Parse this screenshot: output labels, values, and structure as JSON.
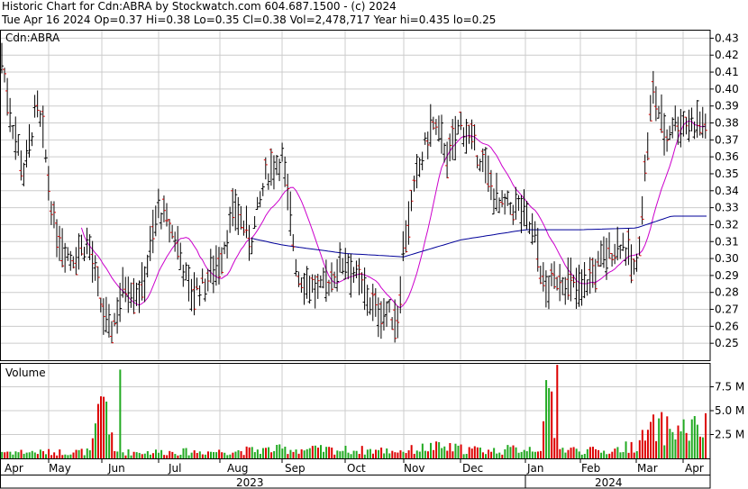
{
  "header": {
    "line1": "Historic Chart for Cdn:ABRA by Stockwatch.com 604.687.1500 - (c) 2024",
    "line2": "Tue Apr 16 2024  Op=0.37  Hi=0.38  Lo=0.35  Cl=0.38  Vol=2,478,717  Year hi=0.435  lo=0.25"
  },
  "colors": {
    "up": "#dd0000",
    "down": "#000000",
    "ma_short": "#cc00cc",
    "ma_long": "#000099",
    "vol_up": "#22aa22",
    "vol_down": "#dd0000"
  },
  "chart_data": {
    "type": "bar",
    "title": "Cdn:ABRA",
    "price_axis": {
      "ylim": [
        0.24,
        0.435
      ],
      "ticks": [
        "0.43",
        "0.42",
        "0.41",
        "0.40",
        "0.39",
        "0.38",
        "0.37",
        "0.36",
        "0.35",
        "0.34",
        "0.33",
        "0.32",
        "0.31",
        "0.30",
        "0.29",
        "0.28",
        "0.27",
        "0.26",
        "0.25"
      ]
    },
    "volume_axis": {
      "label": "Volume",
      "ylim": [
        0,
        10
      ],
      "ticks": [
        "7.5 M",
        "5.0 M",
        "2.5 M"
      ]
    },
    "months": [
      "Apr",
      "May",
      "Jun",
      "Jul",
      "Aug",
      "Sep",
      "Oct",
      "Nov",
      "Dec",
      "Jan",
      "Feb",
      "Mar",
      "Apr"
    ],
    "years": [
      "2023",
      "2024"
    ],
    "price_anchors": [
      {
        "m": 0.0,
        "v": 0.425
      },
      {
        "m": 0.25,
        "v": 0.38
      },
      {
        "m": 0.5,
        "v": 0.35
      },
      {
        "m": 0.75,
        "v": 0.39
      },
      {
        "m": 0.9,
        "v": 0.37
      },
      {
        "m": 1.1,
        "v": 0.32
      },
      {
        "m": 1.4,
        "v": 0.3
      },
      {
        "m": 1.75,
        "v": 0.31
      },
      {
        "m": 2.0,
        "v": 0.27
      },
      {
        "m": 2.15,
        "v": 0.255
      },
      {
        "m": 2.4,
        "v": 0.285
      },
      {
        "m": 2.7,
        "v": 0.28
      },
      {
        "m": 3.0,
        "v": 0.33
      },
      {
        "m": 3.3,
        "v": 0.31
      },
      {
        "m": 3.5,
        "v": 0.28
      },
      {
        "m": 3.75,
        "v": 0.285
      },
      {
        "m": 4.0,
        "v": 0.3
      },
      {
        "m": 4.25,
        "v": 0.33
      },
      {
        "m": 4.5,
        "v": 0.31
      },
      {
        "m": 4.75,
        "v": 0.35
      },
      {
        "m": 5.0,
        "v": 0.36
      },
      {
        "m": 5.25,
        "v": 0.29
      },
      {
        "m": 5.6,
        "v": 0.28
      },
      {
        "m": 6.0,
        "v": 0.3
      },
      {
        "m": 6.5,
        "v": 0.27
      },
      {
        "m": 6.9,
        "v": 0.265
      },
      {
        "m": 7.0,
        "v": 0.31
      },
      {
        "m": 7.25,
        "v": 0.35
      },
      {
        "m": 7.5,
        "v": 0.38
      },
      {
        "m": 7.8,
        "v": 0.36
      },
      {
        "m": 8.0,
        "v": 0.38
      },
      {
        "m": 8.3,
        "v": 0.36
      },
      {
        "m": 8.6,
        "v": 0.33
      },
      {
        "m": 8.9,
        "v": 0.33
      },
      {
        "m": 9.2,
        "v": 0.31
      },
      {
        "m": 9.35,
        "v": 0.28
      },
      {
        "m": 9.6,
        "v": 0.29
      },
      {
        "m": 10.0,
        "v": 0.28
      },
      {
        "m": 10.4,
        "v": 0.3
      },
      {
        "m": 10.75,
        "v": 0.31
      },
      {
        "m": 11.0,
        "v": 0.29
      },
      {
        "m": 11.15,
        "v": 0.34
      },
      {
        "m": 11.35,
        "v": 0.4
      },
      {
        "m": 11.65,
        "v": 0.37
      },
      {
        "m": 11.75,
        "v": 0.38
      }
    ],
    "volume_anchors": [
      {
        "m": 0.0,
        "v": 0.9
      },
      {
        "m": 1.0,
        "v": 0.8
      },
      {
        "m": 1.8,
        "v": 0.9
      },
      {
        "m": 2.05,
        "v": 9.3
      },
      {
        "m": 2.2,
        "v": 0.8
      },
      {
        "m": 4.0,
        "v": 0.9
      },
      {
        "m": 5.0,
        "v": 1.2
      },
      {
        "m": 7.0,
        "v": 1.0
      },
      {
        "m": 7.5,
        "v": 1.5
      },
      {
        "m": 8.5,
        "v": 1.0
      },
      {
        "m": 9.3,
        "v": 1.5
      },
      {
        "m": 9.42,
        "v": 9.8
      },
      {
        "m": 9.6,
        "v": 1.2
      },
      {
        "m": 10.5,
        "v": 0.9
      },
      {
        "m": 11.0,
        "v": 1.8
      },
      {
        "m": 11.4,
        "v": 4.0
      },
      {
        "m": 11.75,
        "v": 3.8
      }
    ],
    "ma_long_anchors": [
      {
        "m": 4.0,
        "v": 0.316
      },
      {
        "m": 5.0,
        "v": 0.308
      },
      {
        "m": 6.0,
        "v": 0.303
      },
      {
        "m": 7.0,
        "v": 0.301
      },
      {
        "m": 8.0,
        "v": 0.311
      },
      {
        "m": 9.0,
        "v": 0.317
      },
      {
        "m": 10.0,
        "v": 0.317
      },
      {
        "m": 11.0,
        "v": 0.318
      },
      {
        "m": 11.75,
        "v": 0.325
      }
    ]
  }
}
